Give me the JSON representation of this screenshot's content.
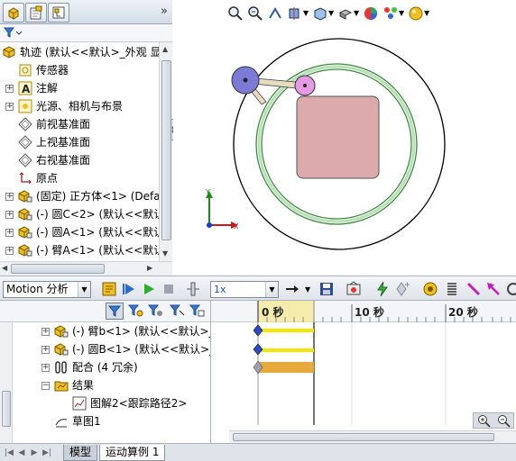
{
  "feature_manager": {
    "tabs": [
      "feature-manager-tab",
      "property-manager-tab",
      "configuration-manager-tab"
    ],
    "collapse_glyph": "»",
    "filter_glyph": "▾",
    "tree": [
      {
        "label": "轨迹  (默认<<默认>_外观 显",
        "icon": "part-icon",
        "expander": ""
      },
      {
        "label": "传感器",
        "icon": "sensor-icon",
        "expander": ""
      },
      {
        "label": "注解",
        "icon": "annotation-icon",
        "expander": "+"
      },
      {
        "label": "光源、相机与布景",
        "icon": "lights-icon",
        "expander": "+"
      },
      {
        "label": "前视基准面",
        "icon": "plane-icon",
        "expander": ""
      },
      {
        "label": "上视基准面",
        "icon": "plane-icon",
        "expander": ""
      },
      {
        "label": "右视基准面",
        "icon": "plane-icon",
        "expander": ""
      },
      {
        "label": "原点",
        "icon": "origin-icon",
        "expander": ""
      },
      {
        "label": "(固定) 正方体<1> (Defa",
        "icon": "component-icon",
        "expander": "+"
      },
      {
        "label": "(-) 圆C<2> (默认<<默认",
        "icon": "component-icon",
        "expander": "+"
      },
      {
        "label": "(-) 圆A<1> (默认<<默认",
        "icon": "component-icon",
        "expander": "+"
      },
      {
        "label": "(-) 臂A<1> (默认<<默认",
        "icon": "component-icon",
        "expander": "+"
      }
    ]
  },
  "motion_toolbar": {
    "study_type": "Motion 分析",
    "playback_speed": "1x",
    "buttons": [
      "calculate-icon",
      "play-from-start-icon",
      "play-icon",
      "stop-icon",
      "timeline-slider-icon",
      "playback-mode-icon",
      "save-animation-icon",
      "animation-wizard-icon",
      "autokey-icon",
      "add-key-icon",
      "motor-icon",
      "spring-icon",
      "contact-icon",
      "force-icon",
      "gravity-icon"
    ]
  },
  "motion_tree": {
    "rows": [
      {
        "label": "(-) 臂b<1> (默认<<默认>_",
        "icon": "component-icon",
        "expander": "+"
      },
      {
        "label": "(-) 圆B<1> (默认<<默认>_",
        "icon": "component-icon",
        "expander": "+"
      },
      {
        "label": "配合 (4 冗余)",
        "icon": "mates-icon",
        "expander": "+"
      },
      {
        "label": "结果",
        "icon": "results-folder-icon",
        "expander": "−"
      },
      {
        "label": "图解2<跟踪路径2>",
        "icon": "plot-icon",
        "expander": ""
      },
      {
        "label": "草图1",
        "icon": "sketch-icon",
        "expander": ""
      }
    ]
  },
  "timeline": {
    "ticks": [
      "0 秒",
      "10 秒",
      "20 秒"
    ],
    "tracks": [
      {
        "row": "臂b",
        "bar_color": "#f5e600"
      },
      {
        "row": "圆B",
        "bar_color": "#f5e600"
      },
      {
        "row": "配合",
        "bar_color": "#e6a93a"
      }
    ]
  },
  "bottom_tabs": [
    "模型",
    "运动算例 1"
  ],
  "colors": {
    "sphere_blue": "#7b7bd6",
    "sphere_pink": "#e69ae6",
    "square": "#dcaaaa",
    "ring": "#3a8a3a"
  }
}
